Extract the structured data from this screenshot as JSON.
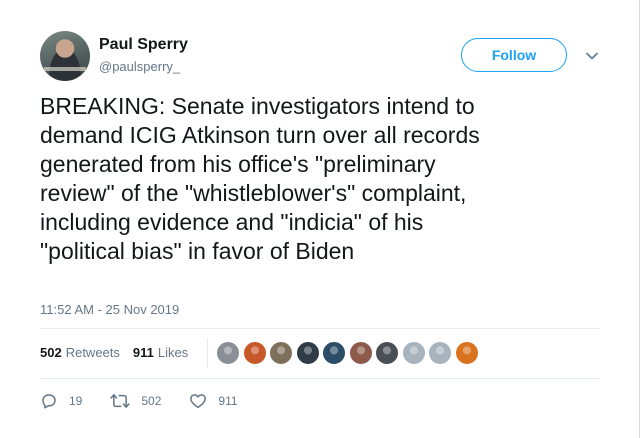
{
  "author": {
    "name": "Paul Sperry",
    "handle": "@paulsperry_"
  },
  "follow_label": "Follow",
  "tweet": {
    "lines": [
      "BREAKING: Senate investigators intend to",
      "demand ICIG Atkinson turn over all records",
      "generated from his office's \"preliminary",
      "review\" of the \"whistleblower's\" complaint,",
      "including evidence and \"indicia\" of his",
      "\"political bias\" in favor of Biden"
    ],
    "timestamp": "11:52 AM - 25 Nov 2019"
  },
  "stats": {
    "retweets_count": "502",
    "retweets_label": "Retweets",
    "likes_count": "911",
    "likes_label": "Likes"
  },
  "likers": [
    {
      "icon": "avatar-liker-1",
      "color": "#8a8f96"
    },
    {
      "icon": "avatar-liker-2",
      "color": "#c8582a"
    },
    {
      "icon": "avatar-liker-3",
      "color": "#7e6f5a"
    },
    {
      "icon": "avatar-liker-4",
      "color": "#2f3b46"
    },
    {
      "icon": "avatar-liker-5",
      "color": "#2b4d66"
    },
    {
      "icon": "avatar-liker-6",
      "color": "#8d5a4c"
    },
    {
      "icon": "avatar-liker-7",
      "color": "#4a4f55"
    },
    {
      "icon": "avatar-liker-8",
      "color": "#a7b3bd"
    },
    {
      "icon": "avatar-liker-9",
      "color": "#a7b3bd"
    },
    {
      "icon": "avatar-liker-10",
      "color": "#d9731f"
    }
  ],
  "actions": {
    "replies": "19",
    "retweets": "502",
    "likes": "911"
  },
  "colors": {
    "accent": "#1da1f2",
    "text": "#14171a",
    "muted": "#657786"
  }
}
